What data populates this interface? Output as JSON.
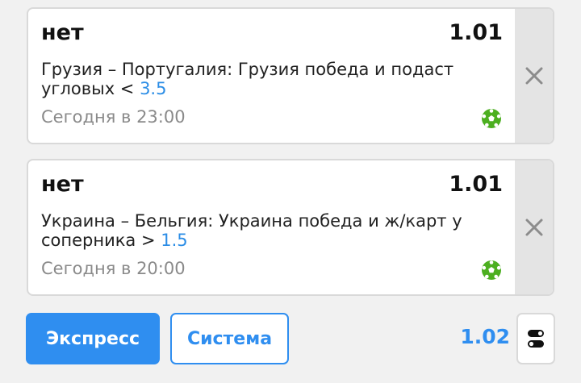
{
  "bets": [
    {
      "title": "нет",
      "odds": "1.01",
      "desc_prefix": "Грузия – Португалия: Грузия победа и подаст угловых < ",
      "desc_value": "3.5",
      "time": "Сегодня в 23:00",
      "sport_icon": "soccer-ball-icon"
    },
    {
      "title": "нет",
      "odds": "1.01",
      "desc_prefix": "Украина – Бельгия: Украина победа и ж/карт у соперника > ",
      "desc_value": "1.5",
      "time": "Сегодня в 20:00",
      "sport_icon": "soccer-ball-icon"
    }
  ],
  "footer": {
    "express_label": "Экспресс",
    "system_label": "Система",
    "total_odds": "1.02",
    "settings_icon": "toggle-settings-icon"
  },
  "colors": {
    "accent": "#2f8ef0",
    "value_blue": "#2b8de6",
    "ball_green": "#4caf20",
    "close_bg": "#e4e4e4",
    "time_gray": "#8a8a8a"
  }
}
